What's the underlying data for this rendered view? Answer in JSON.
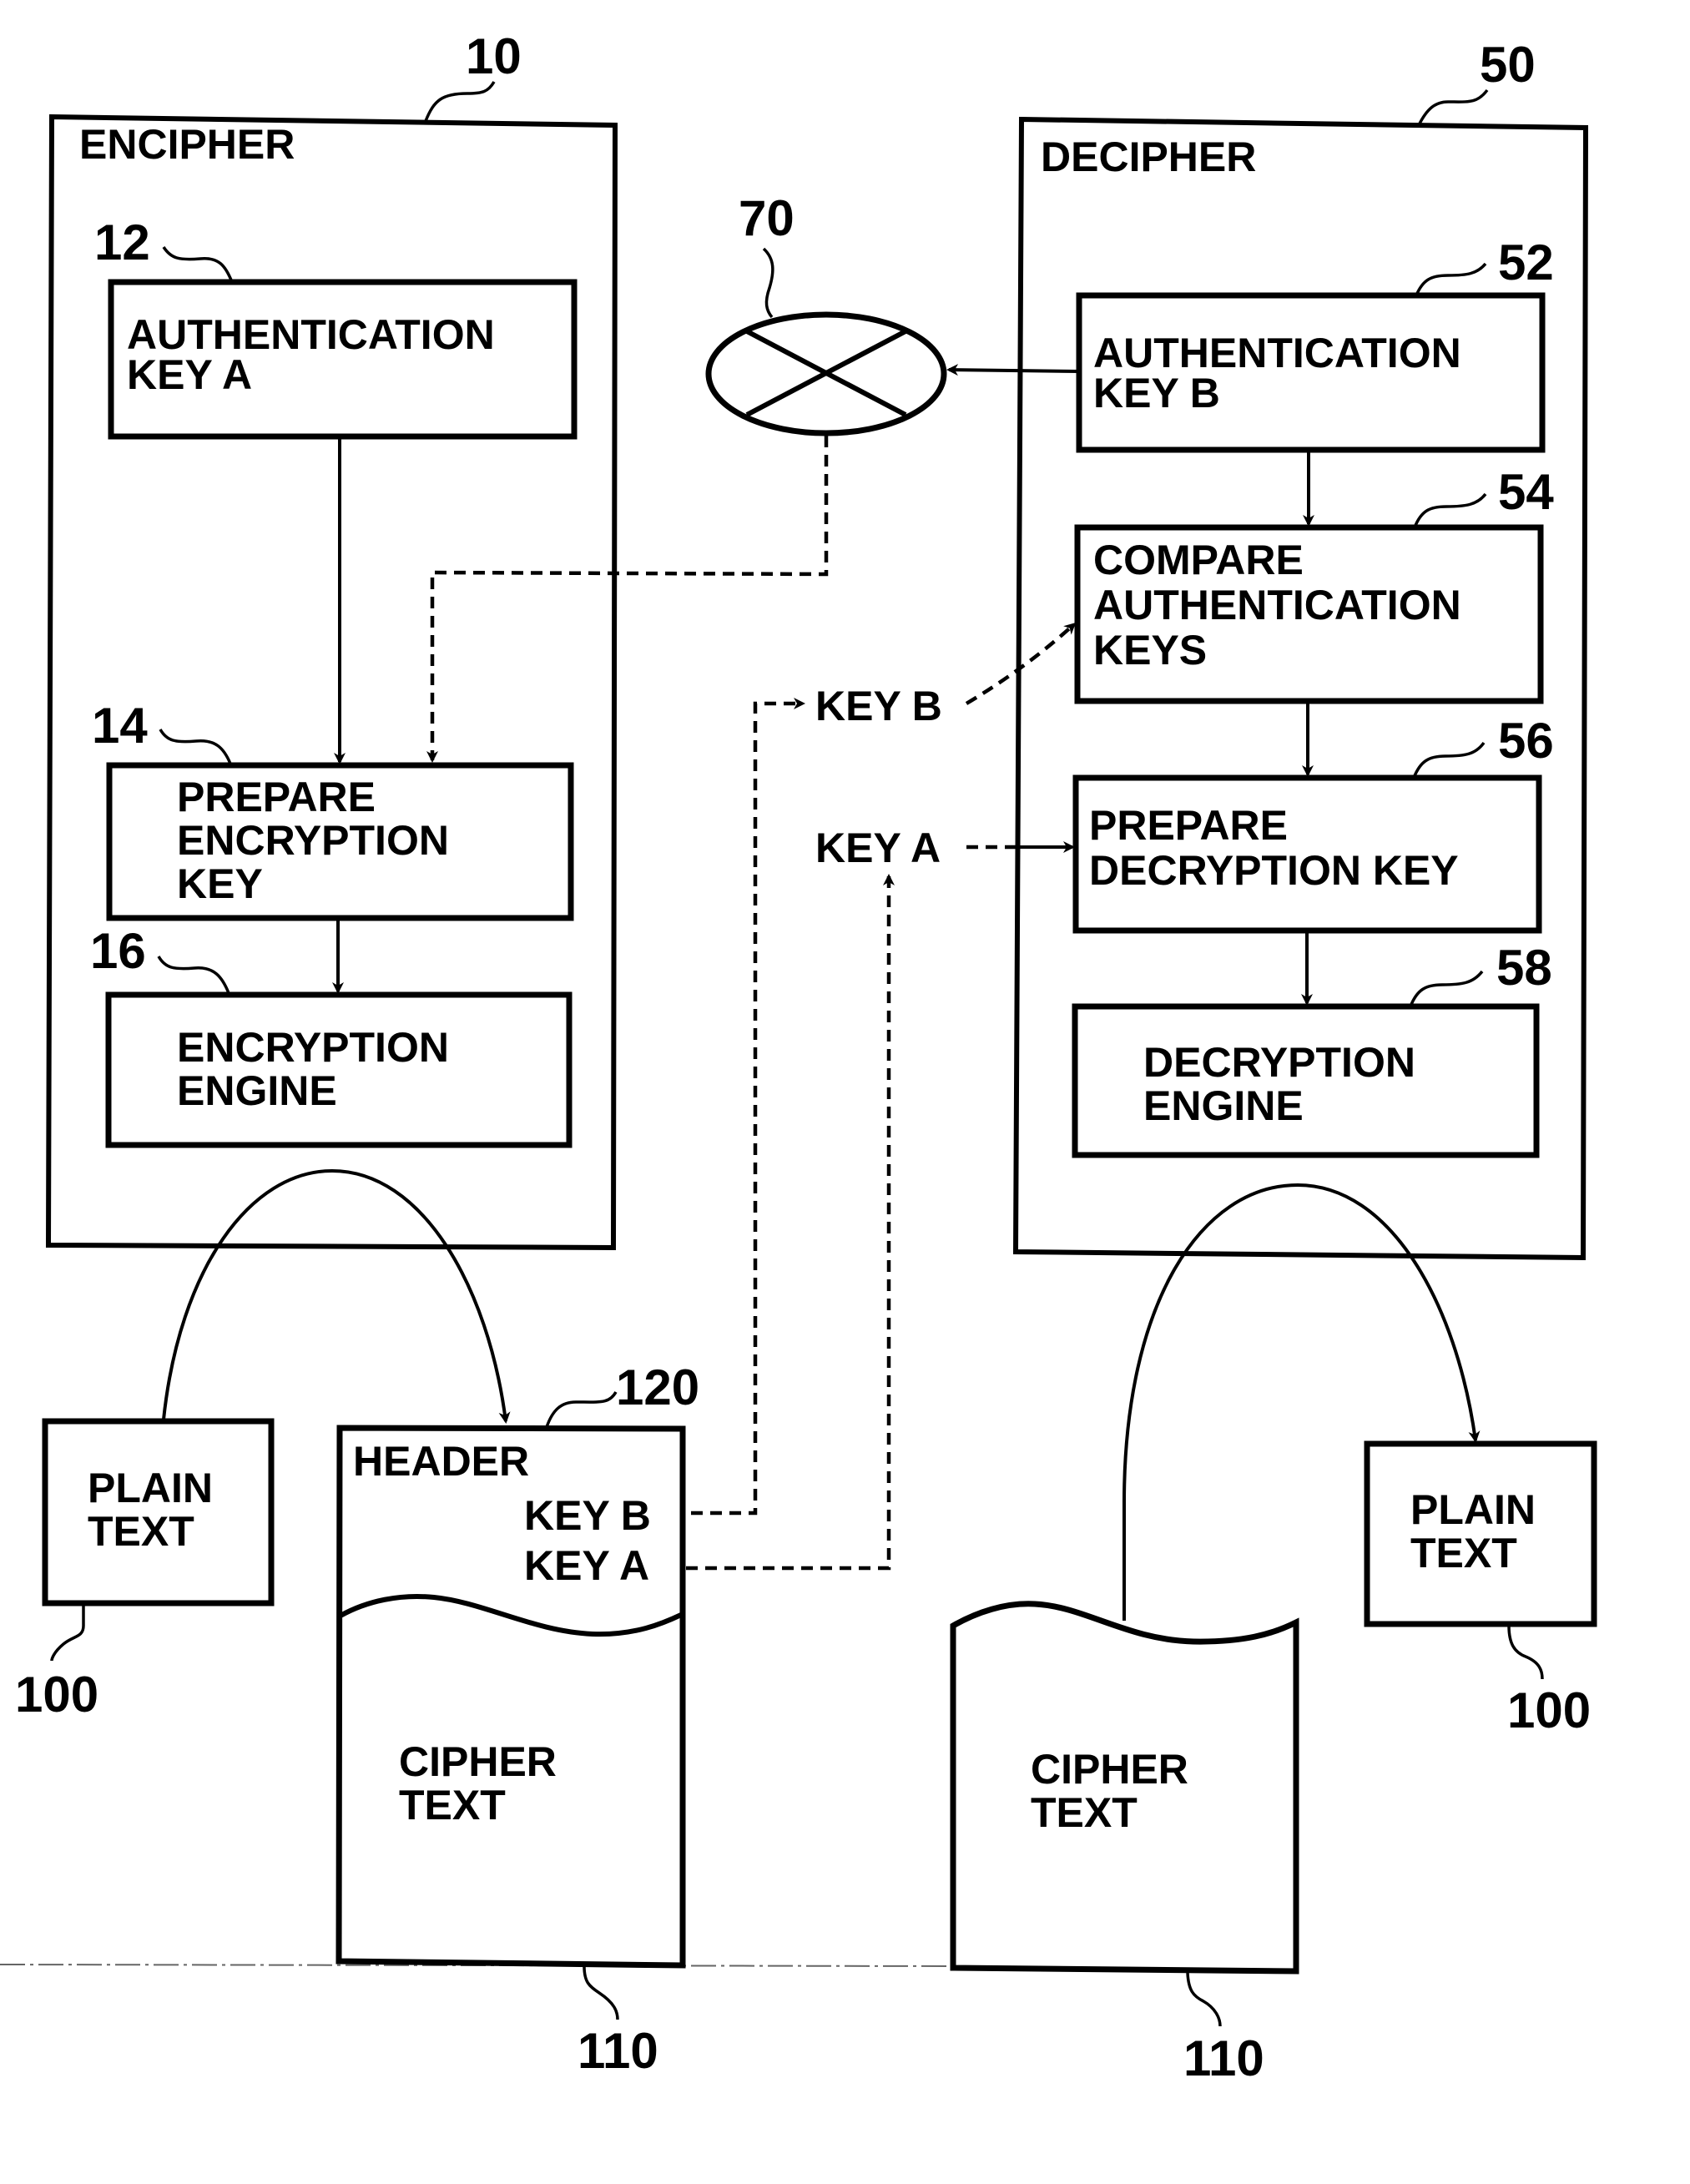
{
  "diagram": {
    "encipher": {
      "title": "ENCIPHER",
      "ref": "10",
      "blocks": [
        {
          "ref": "12",
          "lines": [
            "AUTHENTICATION",
            "KEY A"
          ]
        },
        {
          "ref": "14",
          "lines": [
            "PREPARE",
            "ENCRYPTION",
            "KEY"
          ]
        },
        {
          "ref": "16",
          "lines": [
            "ENCRYPTION",
            "ENGINE"
          ]
        }
      ]
    },
    "decipher": {
      "title": "DECIPHER",
      "ref": "50",
      "blocks": [
        {
          "ref": "52",
          "lines": [
            "AUTHENTICATION",
            "KEY B"
          ]
        },
        {
          "ref": "54",
          "lines": [
            "COMPARE",
            "AUTHENTICATION",
            "KEYS"
          ]
        },
        {
          "ref": "56",
          "lines": [
            "PREPARE",
            "DECRYPTION KEY"
          ]
        },
        {
          "ref": "58",
          "lines": [
            "DECRYPTION",
            "ENGINE"
          ]
        }
      ]
    },
    "combiner": {
      "ref": "70"
    },
    "plain_text_left": {
      "lines": [
        "PLAIN",
        "TEXT"
      ],
      "ref": "100"
    },
    "plain_text_right": {
      "lines": [
        "PLAIN",
        "TEXT"
      ],
      "ref": "100"
    },
    "cipher_doc_left": {
      "header_label": "HEADER",
      "header_ref": "120",
      "header_keys": [
        "KEY B",
        "KEY A"
      ],
      "body_lines": [
        "CIPHER",
        "TEXT"
      ],
      "ref": "110"
    },
    "cipher_doc_right": {
      "body_lines": [
        "CIPHER",
        "TEXT"
      ],
      "ref": "110"
    },
    "floating_labels": {
      "key_b": "KEY B",
      "key_a": "KEY A"
    }
  }
}
